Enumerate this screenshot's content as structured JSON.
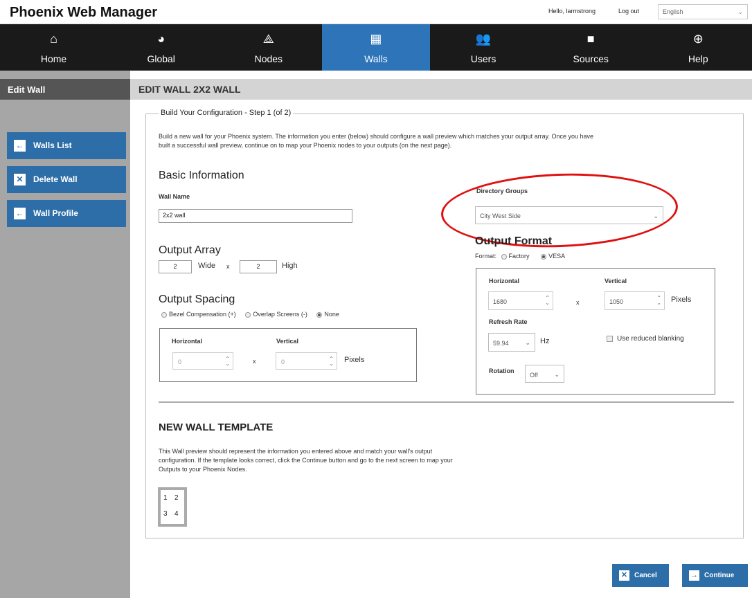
{
  "app": {
    "title": "Phoenix Web Manager",
    "greeting": "Hello, larmstrong",
    "logout": "Log out",
    "language": "English"
  },
  "nav": [
    {
      "label": "Home",
      "icon": "home-icon",
      "glyph": "⌂"
    },
    {
      "label": "Global",
      "icon": "globe-icon",
      "glyph": "◕"
    },
    {
      "label": "Nodes",
      "icon": "nodes-icon",
      "glyph": "⟁"
    },
    {
      "label": "Walls",
      "icon": "grid-icon",
      "glyph": "▦"
    },
    {
      "label": "Users",
      "icon": "users-icon",
      "glyph": "👥"
    },
    {
      "label": "Sources",
      "icon": "camera-icon",
      "glyph": "■"
    },
    {
      "label": "Help",
      "icon": "lifebuoy-icon",
      "glyph": "⊕"
    }
  ],
  "nav_active": "Walls",
  "sidebar": {
    "title": "Edit Wall",
    "buttons": [
      {
        "label": "Walls List",
        "glyph": "←"
      },
      {
        "label": "Delete Wall",
        "glyph": "✕"
      },
      {
        "label": "Wall Profile",
        "glyph": "←"
      }
    ]
  },
  "main": {
    "header": "EDIT WALL 2X2 WALL",
    "legend": "Build Your Configuration - Step 1 (of 2)",
    "intro_line1": "Build a new wall for your Phoenix system. The information you enter (below) should configure a wall preview which matches your output array. Once you have",
    "intro_line2": "built a successful wall preview, continue on to map your Phoenix nodes to your outputs (on the next page).",
    "basic_info": "Basic Information",
    "wall_name_label": "Wall Name",
    "wall_name_value": "2x2 wall",
    "directory_groups_label": "Directory Groups",
    "directory_groups_value": "City West Side",
    "output_array": {
      "title": "Output Array",
      "wide_value": "2",
      "wide_label": "Wide",
      "x": "x",
      "high_value": "2",
      "high_label": "High"
    },
    "output_spacing": {
      "title": "Output Spacing",
      "options": [
        "Bezel Compensation (+)",
        "Overlap Screens (-)",
        "None"
      ],
      "selected": "None",
      "horizontal_label": "Horizontal",
      "vertical_label": "Vertical",
      "horizontal_value": "0",
      "vertical_value": "0",
      "x": "x",
      "pixels": "Pixels"
    },
    "output_format": {
      "title": "Output Format",
      "format_label": "Format:",
      "options": [
        "Factory",
        "VESA"
      ],
      "selected": "VESA",
      "horizontal_label": "Horizontal",
      "vertical_label": "Vertical",
      "horizontal_value": "1680",
      "vertical_value": "1050",
      "x": "x",
      "pixels": "Pixels",
      "refresh_label": "Refresh Rate",
      "refresh_value": "59.94",
      "hz": "Hz",
      "reduced_blanking": "Use reduced blanking",
      "rotation_label": "Rotation",
      "rotation_value": "Off"
    },
    "template": {
      "title": "NEW WALL TEMPLATE",
      "desc_line1": "This Wall preview should represent the information you entered above and match your wall's output",
      "desc_line2": "configuration. If the template looks correct, click the Continue button and go to the next screen to map your",
      "desc_line3": "Outputs to your Phoenix Nodes.",
      "cells": [
        "1",
        "2",
        "3",
        "4"
      ]
    }
  },
  "actions": {
    "cancel": "Cancel",
    "continue": "Continue"
  },
  "colors": {
    "accent": "#2d74b9",
    "button": "#2d6ea8",
    "annotation": "#e01010"
  }
}
